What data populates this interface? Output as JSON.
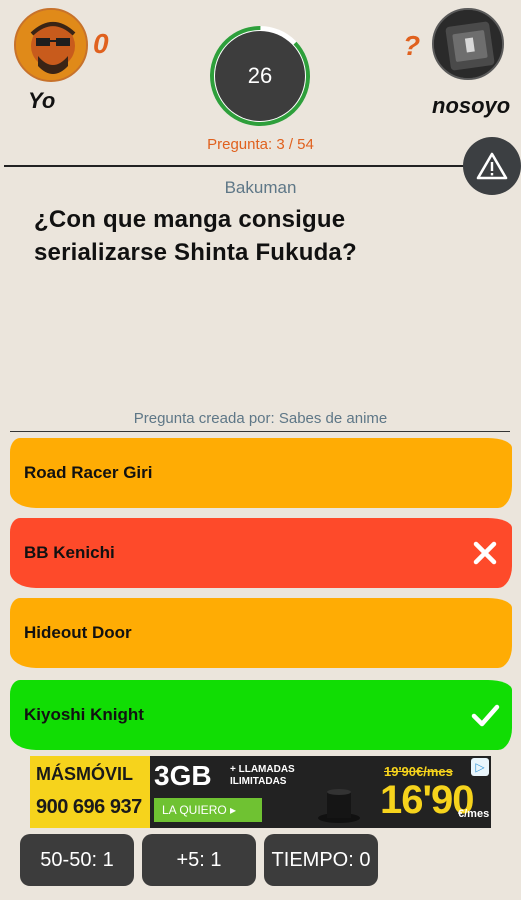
{
  "players": {
    "left": {
      "name": "Yo",
      "score": "0"
    },
    "right": {
      "name": "nosoyo",
      "score": "?"
    }
  },
  "timer": {
    "value": "26",
    "fraction_remaining": 0.87
  },
  "question_counter": "Pregunta: 3 / 54",
  "category": "Bakuman",
  "question": "¿Con que manga consigue serializarse Shinta Fukuda?",
  "author": "Pregunta creada por: Sabes de anime",
  "answers": [
    {
      "label": "Road Racer Giri",
      "state": "neutral",
      "color": "#ffac04"
    },
    {
      "label": "BB Kenichi",
      "state": "wrong",
      "color": "#fe4a2a"
    },
    {
      "label": "Hideout Door",
      "state": "neutral",
      "color": "#ffac04"
    },
    {
      "label": "Kiyoshi Knight",
      "state": "correct",
      "color": "#11dd04"
    }
  ],
  "ad": {
    "brand": "MÁSMÓVIL",
    "phone": "900 696 937",
    "data": "3GB",
    "calls": "+ LLAMADAS ILIMITADAS",
    "cta": "LA QUIERO ▸",
    "old_price": "19'90€/mes",
    "price": "16'90",
    "unit": "€/mes"
  },
  "lifelines": {
    "fifty": "50-50: 1",
    "plus5": "+5: 1",
    "time": "TIEMPO: 0"
  },
  "icons": {
    "report": "warning-triangle-icon",
    "wrong": "close-icon",
    "correct": "checkmark-icon"
  },
  "colors": {
    "background": "#ebe5dc",
    "accent": "#e0611e",
    "timer_ring": "#2e9f3b",
    "muted_text": "#5e7787"
  }
}
